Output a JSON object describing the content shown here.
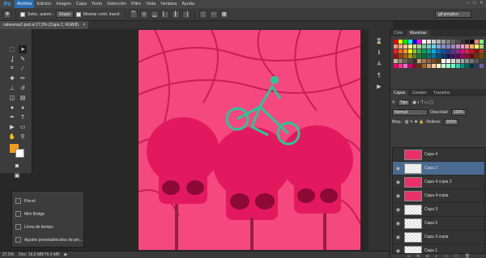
{
  "menubar": {
    "logo": "Ps",
    "items": [
      "Archivo",
      "Edición",
      "Imagen",
      "Capa",
      "Texto",
      "Selección",
      "Filtro",
      "Vista",
      "Ventana",
      "Ayuda"
    ],
    "active_index": 0,
    "window_controls": [
      "–",
      "□",
      "×"
    ]
  },
  "options": {
    "autoselect_label": "Selec. autom.:",
    "autoselect_value": "Grupo",
    "transform_label": "Mostrar contr. transf.",
    "workspace": "gif proudco"
  },
  "document": {
    "tab_label": "calaveras2.psd al 27,5% (Capa 2, RGB/8)"
  },
  "minipanel": {
    "items": [
      "Pincel",
      "Mini Bridge",
      "Línea de tiempo",
      "Ajustes preestablecidos de pin..."
    ]
  },
  "status": {
    "zoom": "27,5%",
    "doc_info": "Doc: 16,0 MB/76,4 MB"
  },
  "right": {
    "swatch_tabs": [
      "Color",
      "Muestras"
    ],
    "swatch_active": 1,
    "layer_tabs": [
      "Capas",
      "Canales",
      "Trazados"
    ],
    "kind_label": "Tipo",
    "blend_mode": "Normal",
    "opacity_label": "Opacidad:",
    "opacity_value": "100%",
    "lock_label": "Bloq.:",
    "fill_label": "Relleno:",
    "fill_value": "100%",
    "layers": [
      {
        "name": "Capa 4",
        "thumb": "pink",
        "visible": false,
        "active": false
      },
      {
        "name": "Capa 2",
        "thumb": "check",
        "visible": true,
        "active": true
      },
      {
        "name": "Capa 4 copia 2",
        "thumb": "pink",
        "visible": true,
        "active": false
      },
      {
        "name": "Capa 4 copia",
        "thumb": "pink",
        "visible": true,
        "active": false
      },
      {
        "name": "Capa 3",
        "thumb": "check",
        "visible": true,
        "active": false
      },
      {
        "name": "Capa 5",
        "thumb": "check",
        "visible": true,
        "active": false
      },
      {
        "name": "Capa 3 copia",
        "thumb": "check",
        "visible": true,
        "active": false
      },
      {
        "name": "Capa 1",
        "thumb": "check",
        "visible": true,
        "active": false
      }
    ]
  },
  "colors": {
    "artwork_bg": "#f4487e",
    "skull": "#e3195f",
    "teal": "#2fc39a",
    "accent_fg": "#f29a1c"
  }
}
